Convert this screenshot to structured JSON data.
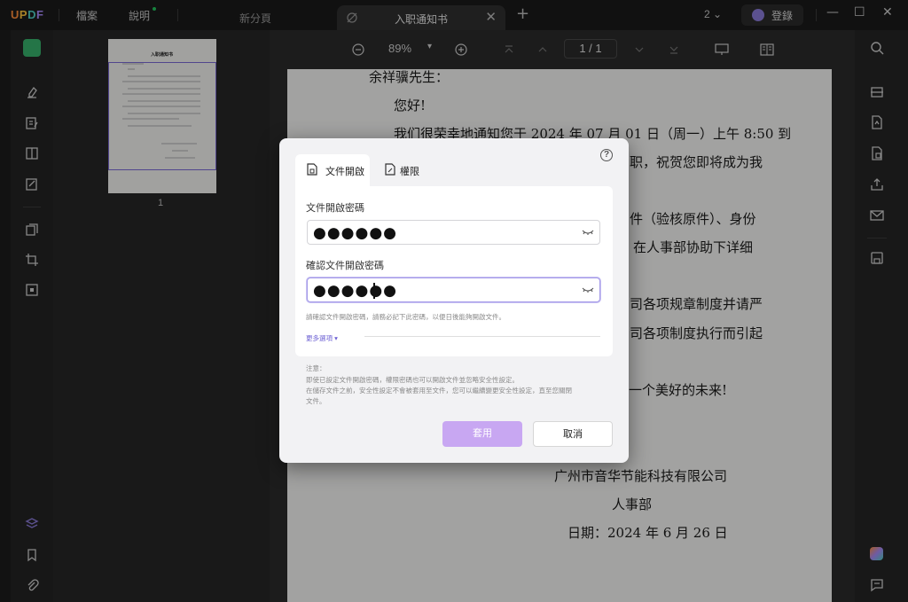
{
  "app": {
    "logo": [
      "U",
      "P",
      "D",
      "F"
    ]
  },
  "menu": {
    "file": "檔案",
    "help": "說明"
  },
  "tabs": [
    {
      "label": "新分頁"
    },
    {
      "label": "入职通知书",
      "close": "✕"
    }
  ],
  "titlebar": {
    "new_tab": "+",
    "page_count": "2 ⌄",
    "login": "登錄",
    "minimize": "—",
    "maximize": "☐",
    "close": "✕"
  },
  "toolbar": {
    "zoom": "89%",
    "zoom_arrow": "▾",
    "page_indicator": "1 / 1"
  },
  "thumbnails": [
    {
      "number": "1",
      "title": "入职通知书"
    }
  ],
  "document": {
    "greeting_name": "余祥骥先生：",
    "hello": "您好!",
    "line1": "我们很荣幸地通知您于 2024 年 07 月 01 日（周一）上午 8:50 到",
    "line2": "职，祝贺您即将成为我",
    "line3": "件（验核原件）、身份",
    "line4": "在人事部协助下详细",
    "line5": "司各项规章制度并请严",
    "line6": "司各项制度执行而引起",
    "line7": "一个美好的未来!",
    "company": "广州市音华节能科技有限公司",
    "department": "人事部",
    "date": "日期：2024 年 6 月 26 日"
  },
  "dialog": {
    "tab_open": "文件開啟",
    "tab_permission": "權限",
    "help": "?",
    "open_password_label": "文件開啟密碼",
    "open_password_value": "●●●●●●",
    "confirm_password_label": "確認文件開啟密碼",
    "confirm_password_value": "●●●●●●",
    "hint": "請確認文件開啟密碼，請務必記下此密碼，以便日後能夠開啟文件。",
    "more_options": "更多選項",
    "more_arrow": "▾",
    "note_title": "注意：",
    "note_line1": "即使已設定文件開啟密碼，權限密碼也可以開啟文件並忽略安全性設定。",
    "note_line2": "在儲存文件之前，安全性設定不會被套用至文件，您可以繼續變更安全性設定，直至您關閉",
    "note_line3": "文件。",
    "apply": "套用",
    "cancel": "取消"
  },
  "colors": {
    "accent": "#8b7bd9",
    "apply_button": "#c8a7f2",
    "logo_u": "#ff8d3a",
    "logo_p": "#ffc53d",
    "logo_d": "#4fd1c5",
    "logo_f": "#a78bfa"
  }
}
